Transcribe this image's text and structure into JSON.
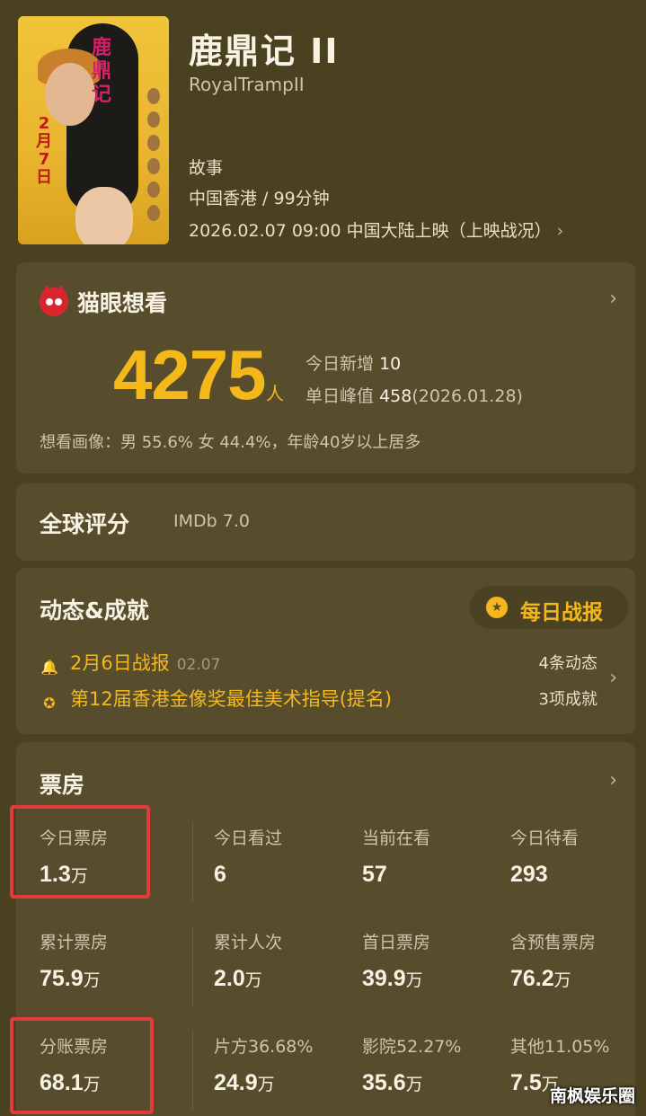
{
  "movie": {
    "title": "鹿鼎记 II",
    "english_title": "RoyalTrampII",
    "genre": "故事",
    "region_duration": "中国香港 / 99分钟",
    "release": "2026.02.07 09:00 中国大陆上映（上映战况）",
    "poster_text": {
      "title": "鹿鼎记",
      "date": "2月7日"
    }
  },
  "maoyan": {
    "header": "猫眼想看",
    "count": "4275",
    "unit": "人",
    "today_label": "今日新增",
    "today_value": "10",
    "peak_label": "单日峰值",
    "peak_value": "458",
    "peak_date": "(2026.01.28)",
    "portrait": "想看画像：男 55.6%  女 44.4%，年龄40岁以上居多"
  },
  "rating": {
    "label": "全球评分",
    "value": "IMDb 7.0"
  },
  "dynamics": {
    "header": "动态&成就",
    "daily_button": "每日战报",
    "news": [
      {
        "text": "2月6日战报",
        "date": "02.07",
        "icon": "bell-icon"
      },
      {
        "text": "第12届香港金像奖最佳美术指导(提名)",
        "icon": "medal-icon"
      }
    ],
    "count_dynamic": "4条动态",
    "count_achieve": "3项成就"
  },
  "box_office": {
    "header": "票房",
    "cells": [
      {
        "label": "今日票房",
        "value": "1.3",
        "unit": "万"
      },
      {
        "label": "今日看过",
        "value": "6",
        "unit": ""
      },
      {
        "label": "当前在看",
        "value": "57",
        "unit": ""
      },
      {
        "label": "今日待看",
        "value": "293",
        "unit": ""
      },
      {
        "label": "累计票房",
        "value": "75.9",
        "unit": "万"
      },
      {
        "label": "累计人次",
        "value": "2.0",
        "unit": "万"
      },
      {
        "label": "首日票房",
        "value": "39.9",
        "unit": "万"
      },
      {
        "label": "含预售票房",
        "value": "76.2",
        "unit": "万"
      },
      {
        "label": "分账票房",
        "value": "68.1",
        "unit": "万"
      },
      {
        "label": "片方36.68%",
        "value": "24.9",
        "unit": "万"
      },
      {
        "label": "影院52.27%",
        "value": "35.6",
        "unit": "万"
      },
      {
        "label": "其他11.05%",
        "value": "7.5",
        "unit": "万"
      }
    ]
  },
  "watermark": "南枫娱乐圈",
  "colors": {
    "accent": "#f5b81b",
    "background": "#4a4121",
    "card": "#574d2d",
    "highlight": "#e23b3b"
  }
}
